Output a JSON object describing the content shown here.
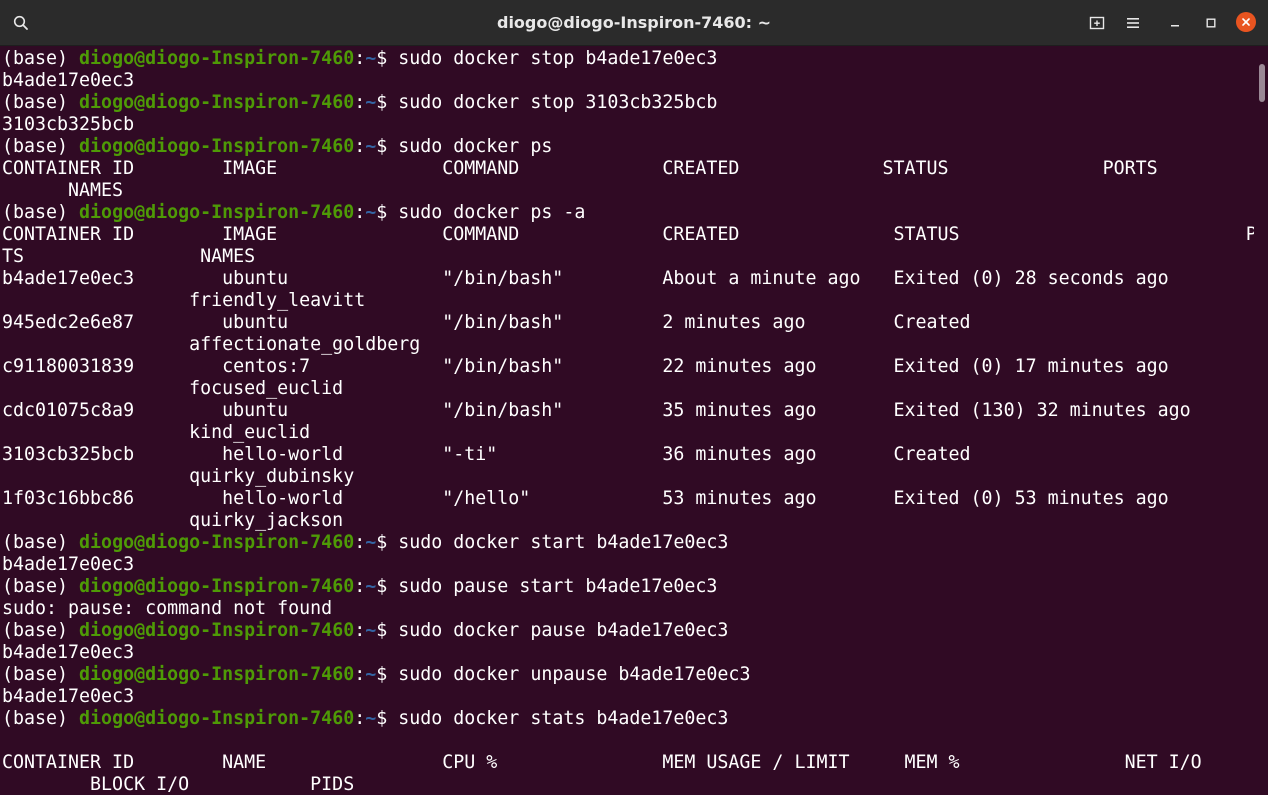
{
  "window": {
    "title": "diogo@diogo-Inspiron-7460: ~",
    "icons": [
      "search-icon",
      "new-tab-icon",
      "menu-icon",
      "minimize-icon",
      "maximize-icon",
      "close-icon"
    ]
  },
  "terminal": {
    "colors": {
      "background": "#300a24",
      "user": "#4e9a06",
      "path": "#3465a4",
      "text": "#ffffff"
    },
    "lines": [
      {
        "prompt": true,
        "base": "(base) ",
        "user": "diogo@diogo-Inspiron-7460",
        "colon": ":",
        "path": "~",
        "cmd": "$ sudo docker stop b4ade17e0ec3"
      },
      {
        "text": "b4ade17e0ec3"
      },
      {
        "prompt": true,
        "base": "(base) ",
        "user": "diogo@diogo-Inspiron-7460",
        "colon": ":",
        "path": "~",
        "cmd": "$ sudo docker stop 3103cb325bcb"
      },
      {
        "text": "3103cb325bcb"
      },
      {
        "prompt": true,
        "base": "(base) ",
        "user": "diogo@diogo-Inspiron-7460",
        "colon": ":",
        "path": "~",
        "cmd": "$ sudo docker ps"
      },
      {
        "text": "CONTAINER ID        IMAGE               COMMAND             CREATED             STATUS              PORTS"
      },
      {
        "text": "      NAMES"
      },
      {
        "prompt": true,
        "base": "(base) ",
        "user": "diogo@diogo-Inspiron-7460",
        "colon": ":",
        "path": "~",
        "cmd": "$ sudo docker ps -a"
      },
      {
        "text": "CONTAINER ID        IMAGE               COMMAND             CREATED              STATUS                          POR"
      },
      {
        "text": "TS                NAMES"
      },
      {
        "text": "b4ade17e0ec3        ubuntu              \"/bin/bash\"         About a minute ago   Exited (0) 28 seconds ago"
      },
      {
        "text": "                 friendly_leavitt"
      },
      {
        "text": "945edc2e6e87        ubuntu              \"/bin/bash\"         2 minutes ago        Created"
      },
      {
        "text": "                 affectionate_goldberg"
      },
      {
        "text": "c91180031839        centos:7            \"/bin/bash\"         22 minutes ago       Exited (0) 17 minutes ago"
      },
      {
        "text": "                 focused_euclid"
      },
      {
        "text": "cdc01075c8a9        ubuntu              \"/bin/bash\"         35 minutes ago       Exited (130) 32 minutes ago"
      },
      {
        "text": "                 kind_euclid"
      },
      {
        "text": "3103cb325bcb        hello-world         \"-ti\"               36 minutes ago       Created"
      },
      {
        "text": "                 quirky_dubinsky"
      },
      {
        "text": "1f03c16bbc86        hello-world         \"/hello\"            53 minutes ago       Exited (0) 53 minutes ago"
      },
      {
        "text": "                 quirky_jackson"
      },
      {
        "prompt": true,
        "base": "(base) ",
        "user": "diogo@diogo-Inspiron-7460",
        "colon": ":",
        "path": "~",
        "cmd": "$ sudo docker start b4ade17e0ec3"
      },
      {
        "text": "b4ade17e0ec3"
      },
      {
        "prompt": true,
        "base": "(base) ",
        "user": "diogo@diogo-Inspiron-7460",
        "colon": ":",
        "path": "~",
        "cmd": "$ sudo pause start b4ade17e0ec3"
      },
      {
        "text": "sudo: pause: command not found"
      },
      {
        "prompt": true,
        "base": "(base) ",
        "user": "diogo@diogo-Inspiron-7460",
        "colon": ":",
        "path": "~",
        "cmd": "$ sudo docker pause b4ade17e0ec3"
      },
      {
        "text": "b4ade17e0ec3"
      },
      {
        "prompt": true,
        "base": "(base) ",
        "user": "diogo@diogo-Inspiron-7460",
        "colon": ":",
        "path": "~",
        "cmd": "$ sudo docker unpause b4ade17e0ec3"
      },
      {
        "text": "b4ade17e0ec3"
      },
      {
        "prompt": true,
        "base": "(base) ",
        "user": "diogo@diogo-Inspiron-7460",
        "colon": ":",
        "path": "~",
        "cmd": "$ sudo docker stats b4ade17e0ec3"
      },
      {
        "text": ""
      },
      {
        "text": "CONTAINER ID        NAME                CPU %               MEM USAGE / LIMIT     MEM %               NET I/O"
      },
      {
        "text": "        BLOCK I/O           PIDS"
      }
    ]
  }
}
